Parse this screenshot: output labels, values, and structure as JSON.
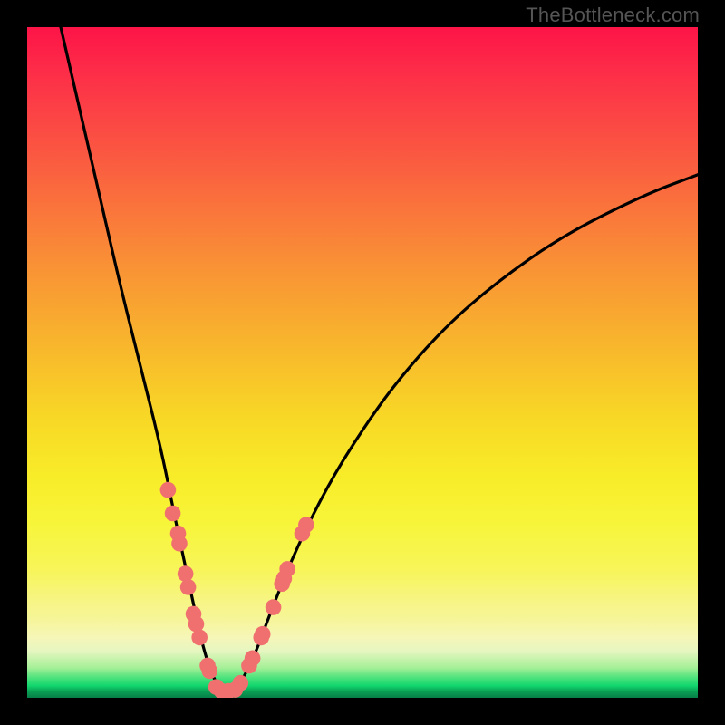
{
  "attribution": "TheBottleneck.com",
  "chart_data": {
    "type": "line",
    "title": "",
    "xlabel": "",
    "ylabel": "",
    "xlim": [
      0,
      100
    ],
    "ylim": [
      0,
      100
    ],
    "grid": false,
    "legend": false,
    "series": [
      {
        "name": "curve",
        "x": [
          5,
          8,
          11,
          14,
          17,
          20,
          22,
          23.5,
          25,
          26,
          27,
          28,
          29,
          30,
          31,
          32,
          34,
          36,
          40,
          45,
          50,
          55,
          62,
          70,
          80,
          92,
          100
        ],
        "y": [
          100,
          87,
          74,
          61,
          49,
          37,
          27,
          20,
          13,
          8.5,
          5,
          2.5,
          1.3,
          1,
          1.3,
          2.5,
          6.5,
          12,
          22,
          32,
          40,
          47,
          55,
          62,
          69,
          75,
          78
        ]
      }
    ],
    "markers": [
      {
        "x": 21.0,
        "y": 31.0
      },
      {
        "x": 21.7,
        "y": 27.5
      },
      {
        "x": 22.5,
        "y": 24.5
      },
      {
        "x": 22.7,
        "y": 23.0
      },
      {
        "x": 23.6,
        "y": 18.5
      },
      {
        "x": 24.0,
        "y": 16.5
      },
      {
        "x": 24.8,
        "y": 12.5
      },
      {
        "x": 25.2,
        "y": 11.0
      },
      {
        "x": 25.7,
        "y": 9.0
      },
      {
        "x": 26.9,
        "y": 4.8
      },
      {
        "x": 27.2,
        "y": 4.0
      },
      {
        "x": 28.2,
        "y": 1.6
      },
      {
        "x": 29.0,
        "y": 1.0
      },
      {
        "x": 30.0,
        "y": 1.0
      },
      {
        "x": 31.0,
        "y": 1.2
      },
      {
        "x": 31.8,
        "y": 2.2
      },
      {
        "x": 33.1,
        "y": 4.8
      },
      {
        "x": 33.6,
        "y": 5.9
      },
      {
        "x": 34.9,
        "y": 9.0
      },
      {
        "x": 35.1,
        "y": 9.5
      },
      {
        "x": 36.7,
        "y": 13.5
      },
      {
        "x": 38.0,
        "y": 17.0
      },
      {
        "x": 38.3,
        "y": 17.8
      },
      {
        "x": 38.8,
        "y": 19.2
      },
      {
        "x": 41.0,
        "y": 24.5
      },
      {
        "x": 41.6,
        "y": 25.8
      }
    ],
    "colors": {
      "curve": "#000000",
      "markers": "#f07070"
    }
  }
}
